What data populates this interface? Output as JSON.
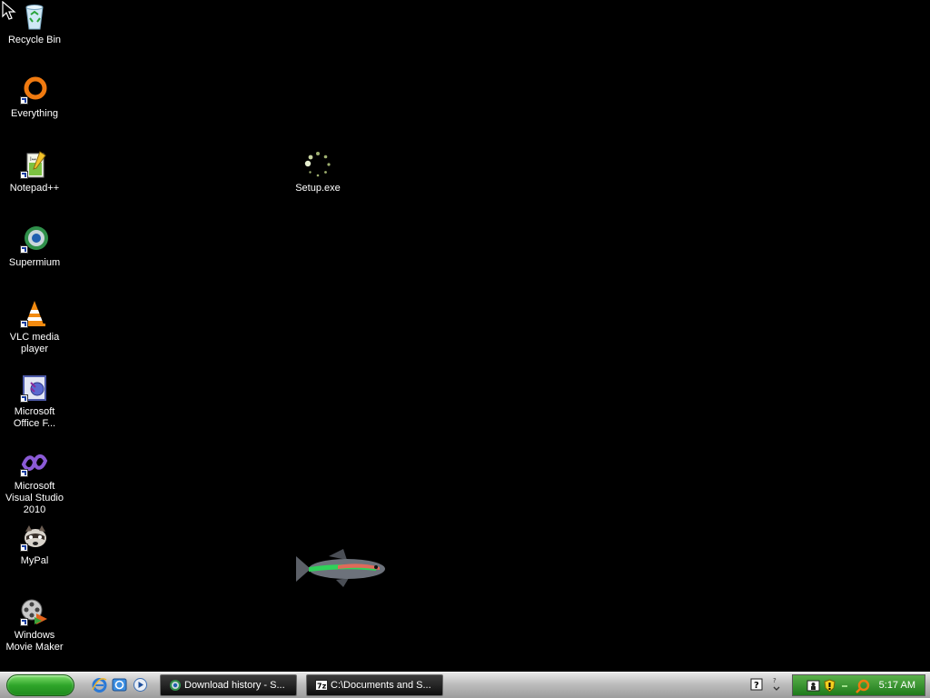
{
  "desktop": {
    "icons": [
      {
        "label": "Recycle Bin",
        "icon": "recycle-bin-icon"
      },
      {
        "label": "Everything",
        "icon": "everything-search-icon"
      },
      {
        "label": "Notepad++",
        "icon": "notepad-plus-plus-icon"
      },
      {
        "label": "Supermium",
        "icon": "supermium-browser-icon"
      },
      {
        "label": "VLC media player",
        "icon": "vlc-cone-icon"
      },
      {
        "label": "Microsoft Office F...",
        "icon": "office-frontpage-icon"
      },
      {
        "label": "Microsoft Visual Studio 2010",
        "icon": "visual-studio-icon"
      },
      {
        "label": "MyPal",
        "icon": "mypal-raccoon-icon"
      },
      {
        "label": "Windows Movie Maker",
        "icon": "movie-maker-icon"
      },
      {
        "label": "Setup.exe",
        "icon": "loading-spinner-icon"
      }
    ]
  },
  "taskbar": {
    "quick_launch": [
      "internet-explorer-icon",
      "outlook-express-icon",
      "media-player-icon"
    ],
    "tasks": [
      {
        "label": "Download history - S...",
        "icon": "supermium-browser-icon"
      },
      {
        "label": "C:\\Documents and S...",
        "icon": "7zip-icon"
      }
    ],
    "tray": {
      "icons": [
        "help-icon",
        "network-icon",
        "security-shield-icon",
        "everything-search-icon"
      ],
      "clock": "5:17 AM"
    }
  },
  "colors": {
    "desktop_bg": "#000000",
    "taskbar_bg": "#b5b5b5",
    "start_green": "#2fa52a",
    "tray_green": "#2e8a29"
  }
}
